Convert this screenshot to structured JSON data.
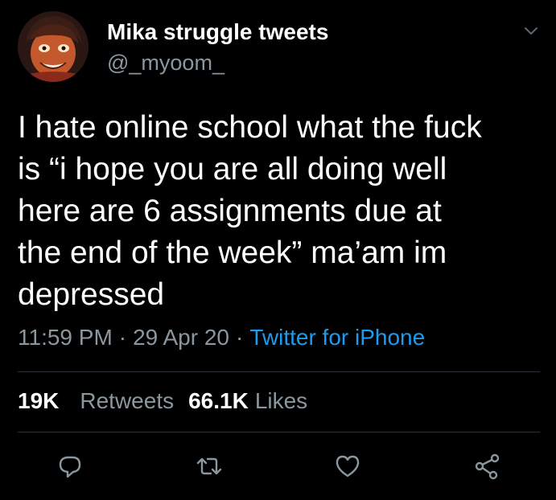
{
  "author": {
    "display_name": "Mika struggle tweets",
    "handle": "@_myoom_"
  },
  "tweet": {
    "text": "I hate online school what the fuck\nis “i hope you are all doing well\nhere are 6 assignments due at\nthe end of the week” ma’am im\ndepressed",
    "time": "11:59 PM",
    "date": "29 Apr 20",
    "separator": "·",
    "source": "Twitter for iPhone"
  },
  "stats": {
    "retweets_count": "19K",
    "retweets_label": "Retweets",
    "likes_count": "66.1K",
    "likes_label": "Likes"
  },
  "icons": {
    "avatar": "avatar-illustration",
    "menu": "chevron-down-icon",
    "reply": "reply-icon",
    "retweet": "retweet-icon",
    "like": "heart-icon",
    "share": "share-icon"
  },
  "colors": {
    "background": "#000000",
    "text": "#ffffff",
    "secondary": "#8b979f",
    "link": "#1d9bf0"
  }
}
